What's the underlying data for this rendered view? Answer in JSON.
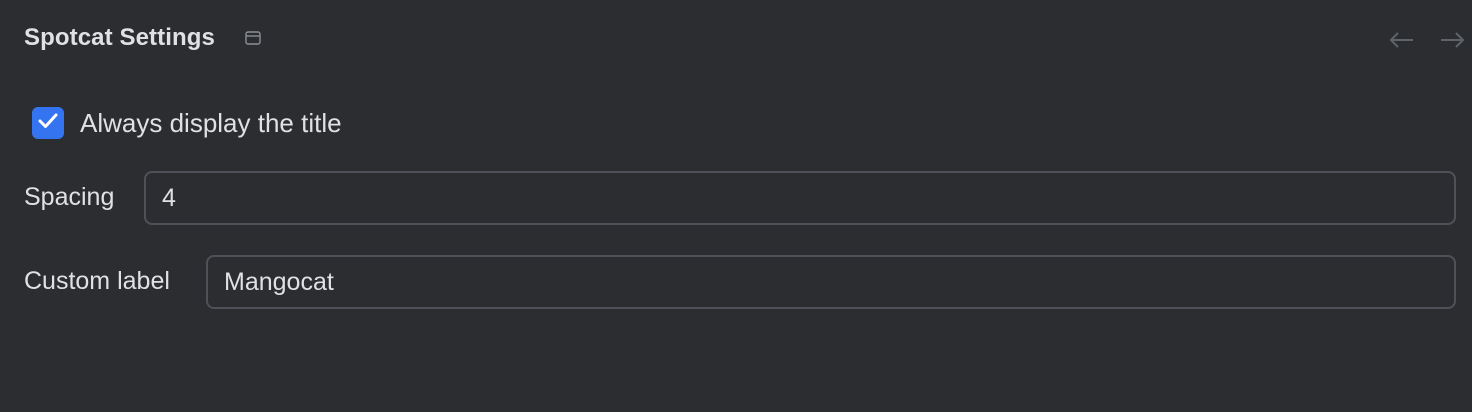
{
  "header": {
    "title": "Spotcat Settings",
    "window_icon": "window-icon",
    "back_icon": "arrow-left-icon",
    "forward_icon": "arrow-right-icon"
  },
  "checkbox": {
    "label": "Always display the title",
    "checked": true
  },
  "fields": {
    "spacing": {
      "label": "Spacing",
      "value": "4"
    },
    "custom_label": {
      "label": "Custom label",
      "value": "Mangocat"
    }
  },
  "colors": {
    "background": "#2b2d30",
    "accent": "#3574f0",
    "border": "#4e5157",
    "text": "#dfe1e5",
    "muted_icon": "#6f737a"
  }
}
